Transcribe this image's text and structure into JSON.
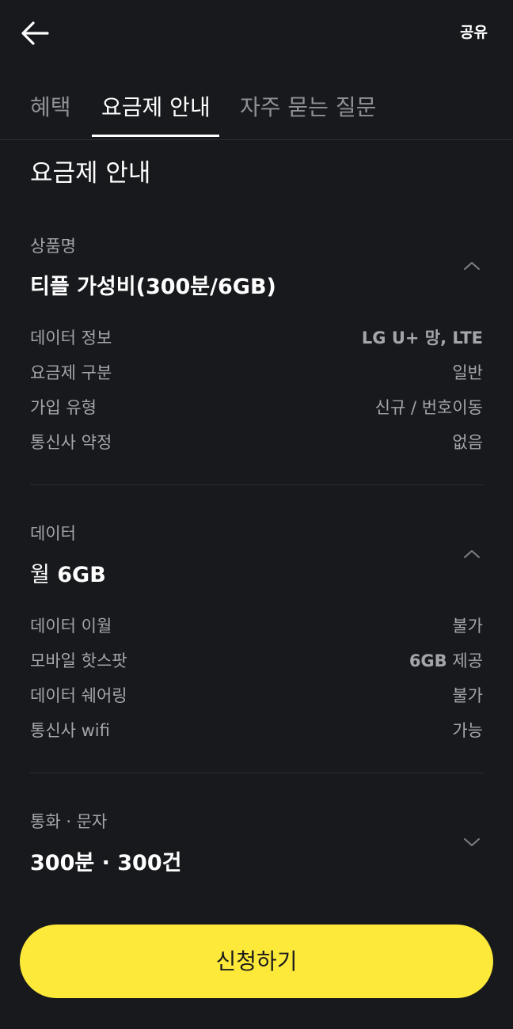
{
  "header": {
    "share_label": "공유"
  },
  "tabs": [
    {
      "label": "혜택",
      "active": false
    },
    {
      "label": "요금제 안내",
      "active": true
    },
    {
      "label": "자주 묻는 질문",
      "active": false
    }
  ],
  "section_title": "요금제 안내",
  "product": {
    "label": "상품명",
    "value": "티플 가성비(300분/6GB)",
    "expanded": true,
    "rows": [
      {
        "label": "데이터 정보",
        "value": "LG U+ 망, LTE"
      },
      {
        "label": "요금제 구분",
        "value": "일반"
      },
      {
        "label": "가입 유형",
        "value": "신규 / 번호이동"
      },
      {
        "label": "통신사 약정",
        "value": "없음"
      }
    ]
  },
  "data_group": {
    "label": "데이터",
    "value_prefix": "월",
    "value_amount": "6GB",
    "expanded": true,
    "rows": [
      {
        "label": "데이터 이월",
        "value": "불가"
      },
      {
        "label": "모바일 핫스팟",
        "value_bold": "6GB",
        "value_suffix": "제공"
      },
      {
        "label": "데이터 쉐어링",
        "value": "불가"
      },
      {
        "label": "통신사 wifi",
        "value": "가능"
      }
    ]
  },
  "call_group": {
    "label": "통화 · 문자",
    "value": "300분 · 300건",
    "expanded": false
  },
  "cta": {
    "label": "신청하기"
  },
  "colors": {
    "background": "#17191c",
    "accent": "#fde93a",
    "muted_text": "#a3a6aa"
  }
}
